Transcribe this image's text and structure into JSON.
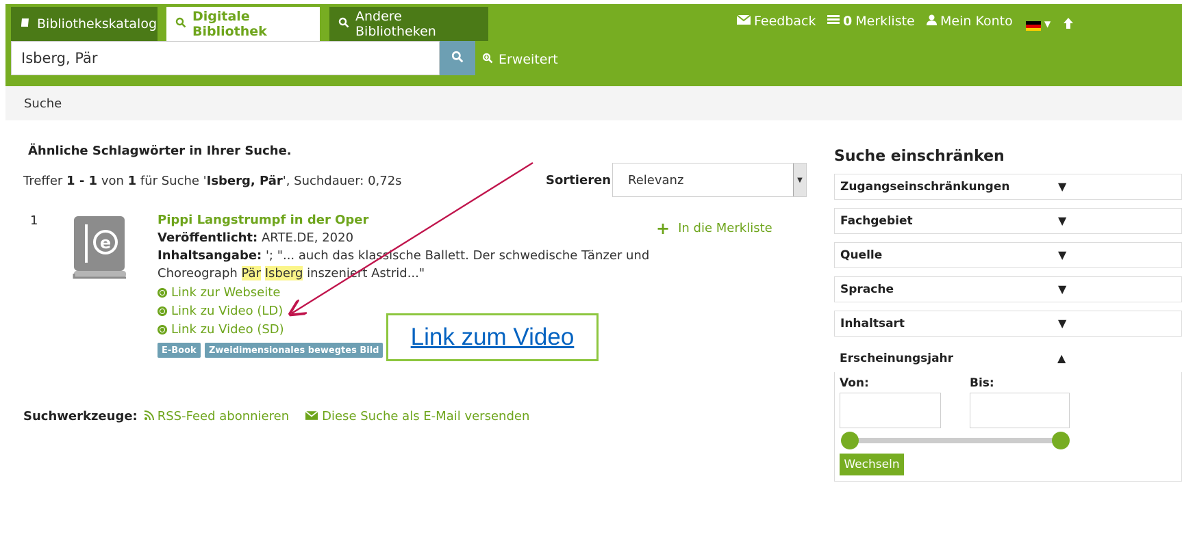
{
  "header": {
    "tabs": [
      {
        "icon": "book-icon",
        "label": "Bibliothekskatalog"
      },
      {
        "icon": "search-icon",
        "label": "Digitale Bibliothek",
        "active": true
      },
      {
        "icon": "search-icon",
        "label": "Andere Bibliotheken"
      }
    ],
    "nav": {
      "feedback": "Feedback",
      "merkliste_count": "0",
      "merkliste": "Merkliste",
      "account": "Mein Konto"
    },
    "search": {
      "value": "Isberg, Pär"
    },
    "advanced": "Erweitert"
  },
  "breadcrumb": "Suche",
  "results": {
    "similar_heading": "Ähnliche Schlagwörter in Ihrer Suche.",
    "hits": {
      "prefix": "Treffer ",
      "range": "1 - 1",
      "of": " von ",
      "total": "1",
      "for": " für Suche '",
      "query": "Isberg, Pär",
      "duration": "', Suchdauer: 0,72s"
    },
    "sort_label": "Sortieren",
    "sort_value": "Relevanz",
    "items": [
      {
        "number": "1",
        "title": "Pippi Langstrumpf in der Oper",
        "published_label": "Veröffentlicht:",
        "published": " ARTE.DE, 2020",
        "summary_label": "Inhaltsangabe:",
        "summary_1": " '; \"... auch das klassische Ballett. Der schwedische Tänzer und",
        "summary_2_pre": "Choreograph ",
        "summary_2_hl1": "Pär",
        "summary_2_hl2": "Isberg",
        "summary_2_post": " inszeniert Astrid...\"",
        "links": [
          "Link zur Webseite",
          "Link zu Video (LD)",
          "Link zu Video (SD)"
        ],
        "badges": [
          "E-Book",
          "Zweidimensionales bewegtes Bild"
        ],
        "add_to_list": "In die Merkliste"
      }
    ],
    "tools_label": "Suchwerkzeuge:",
    "tools": [
      "RSS-Feed abonnieren",
      "Diese Suche als E-Mail versenden"
    ]
  },
  "callout": "Link zum Video",
  "filters": {
    "title": "Suche einschränken",
    "facets": [
      "Zugangseinschränkungen",
      "Fachgebiet",
      "Quelle",
      "Sprache",
      "Inhaltsart"
    ],
    "year_facet": "Erscheinungsjahr",
    "from_label": "Von:",
    "to_label": "Bis:",
    "apply": "Wechseln"
  },
  "colors": {
    "brand_green": "#77ad22",
    "link_green": "#6ea51c",
    "badge_blue": "#6d9fb3",
    "arrow": "#c0144c"
  }
}
